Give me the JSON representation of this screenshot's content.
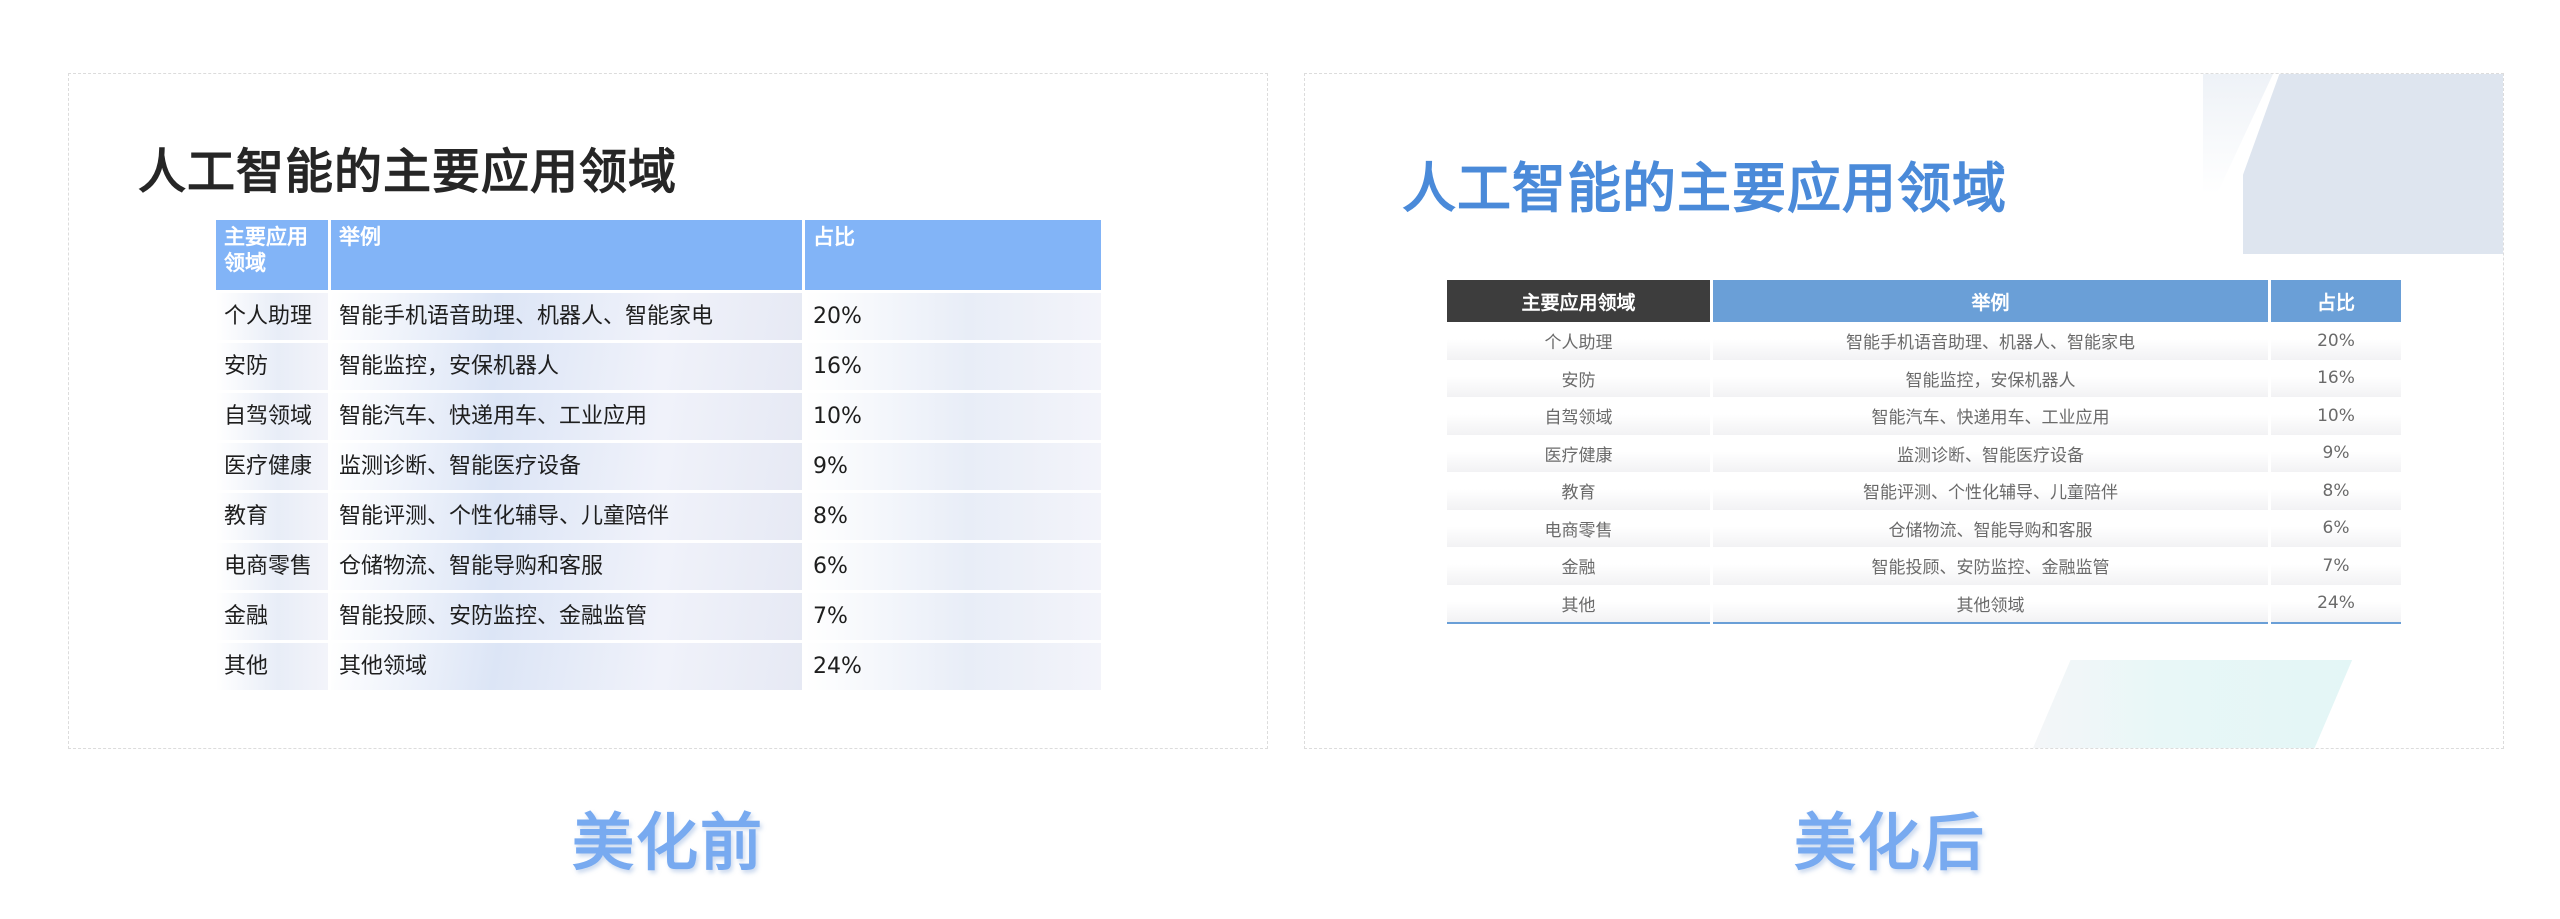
{
  "title": "人工智能的主要应用领域",
  "columns": [
    "主要应用领域",
    "举例",
    "占比"
  ],
  "rows": [
    {
      "area": "个人助理",
      "example": "智能手机语音助理、机器人、智能家电",
      "share": "20%"
    },
    {
      "area": "安防",
      "example": "智能监控，安保机器人",
      "share": "16%"
    },
    {
      "area": "自驾领域",
      "example": "智能汽车、快递用车、工业应用",
      "share": "10%"
    },
    {
      "area": "医疗健康",
      "example": "监测诊断、智能医疗设备",
      "share": "9%"
    },
    {
      "area": "教育",
      "example": "智能评测、个性化辅导、儿童陪伴",
      "share": "8%"
    },
    {
      "area": "电商零售",
      "example": "仓储物流、智能导购和客服",
      "share": "6%"
    },
    {
      "area": "金融",
      "example": "智能投顾、安防监控、金融监管",
      "share": "7%"
    },
    {
      "area": "其他",
      "example": "其他领域",
      "share": "24%"
    }
  ],
  "captions": {
    "before": "美化前",
    "after": "美化后"
  },
  "colors": {
    "before_header": "#82b4f7",
    "after_title": "#4a8ad9",
    "after_header_dark": "#3d3d3d",
    "after_header_blue": "#6a9fd7",
    "caption": "#78aaf0"
  }
}
